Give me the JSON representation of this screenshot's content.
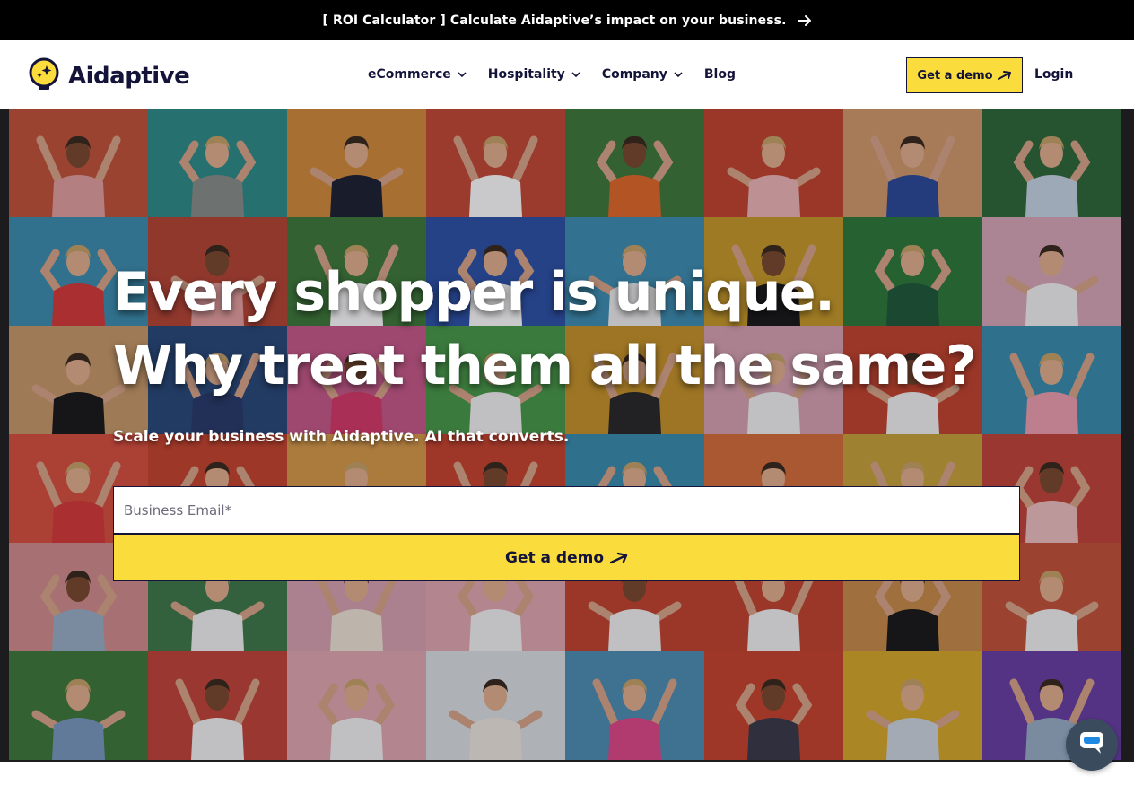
{
  "announcement": {
    "text": "[ ROI Calculator ] Calculate Aidaptive’s impact on your business.",
    "icon": "arrow-right-icon"
  },
  "header": {
    "logo_text": "Aidaptive",
    "logo_icon": "lightbulb-sparkle-icon",
    "nav": [
      {
        "label": "eCommerce",
        "has_dropdown": true
      },
      {
        "label": "Hospitality",
        "has_dropdown": true
      },
      {
        "label": "Company",
        "has_dropdown": true
      },
      {
        "label": "Blog",
        "has_dropdown": false
      }
    ],
    "demo_label": "Get a demo",
    "login_label": "Login"
  },
  "hero": {
    "headline_line1": "Every shopper is unique.",
    "headline_line2": "Why treat them all the same?",
    "subline": "Scale your business with Aidaptive. AI that converts.",
    "email_placeholder": "Business Email*",
    "email_value": "",
    "cta_label": "Get a demo",
    "tile_colors": [
      [
        "#c4543a",
        "#2f8f8a",
        "#d48c3c",
        "#c54a36",
        "#3f7a3a",
        "#c5452f",
        "#d49a6c",
        "#2f6a3a"
      ],
      [
        "#3d8fb0",
        "#b84635",
        "#3f7a3a",
        "#2e52a8",
        "#3e8fb2",
        "#c89a2a",
        "#2f7a3a",
        "#d9a8b8"
      ],
      [
        "#c89a6a",
        "#2a4a7a",
        "#c85a8a",
        "#4a9a4a",
        "#c8942a",
        "#d9a3b3",
        "#c5452f",
        "#3a8fb0"
      ],
      [
        "#d9503f",
        "#c7452f",
        "#d99a4a",
        "#c8452f",
        "#3a8fb0",
        "#d86f3c",
        "#c9a53a",
        "#c5453a"
      ],
      [
        "#d48d8d",
        "#3f7a4a",
        "#d9a3b3",
        "#e3a9b3",
        "#c5452f",
        "#c5452f",
        "#c98c4a",
        "#c4523a"
      ],
      [
        "#3f7a3a",
        "#c5453a",
        "#e3a9b3",
        "#dde0e3",
        "#4f8fb5",
        "#c9452f",
        "#d8aa2a",
        "#6a3fa5"
      ]
    ],
    "tile_shirt_colors": [
      [
        "#e4a0a0",
        "#8a8f8a",
        "#1e2233",
        "#ffffff",
        "#e36a2a",
        "#f0b8b8",
        "#2c4a9a",
        "#c8d6e6"
      ],
      [
        "#d83a3a",
        "#e8a0a0",
        "#ffffff",
        "#ffffff",
        "#f0f0f0",
        "#1a1a1a",
        "#1f5a3a",
        "#f4f4f4"
      ],
      [
        "#1a1a1a",
        "#2a3a6a",
        "#d83a6a",
        "#f4f4f4",
        "#2a2a2a",
        "#f4f4f4",
        "#f4f4f4",
        "#f0a0b0"
      ],
      [
        "#d83a3a",
        "#1a1a1a",
        "#e0e0e0",
        "#f0f0f0",
        "#1a1a1a",
        "#f4f4f4",
        "#f4f4f4",
        "#f0c0c0"
      ],
      [
        "#9ab0c8",
        "#f4f4f4",
        "#f0e6d8",
        "#f4f4f4",
        "#f4f4f4",
        "#f4f4f4",
        "#1a1a1a",
        "#f4f4f4"
      ],
      [
        "#7a9ac0",
        "#f4f4f4",
        "#f4f4f4",
        "#f0e8e0",
        "#e04a8a",
        "#3a3a4a",
        "#d0d8e0",
        "#9ab0c8"
      ]
    ],
    "chat_icon": "chat-bubble-icon"
  },
  "colors": {
    "brand_yellow": "#fadc3c",
    "brand_navy": "#14143a",
    "announcement_bg": "#000000"
  }
}
